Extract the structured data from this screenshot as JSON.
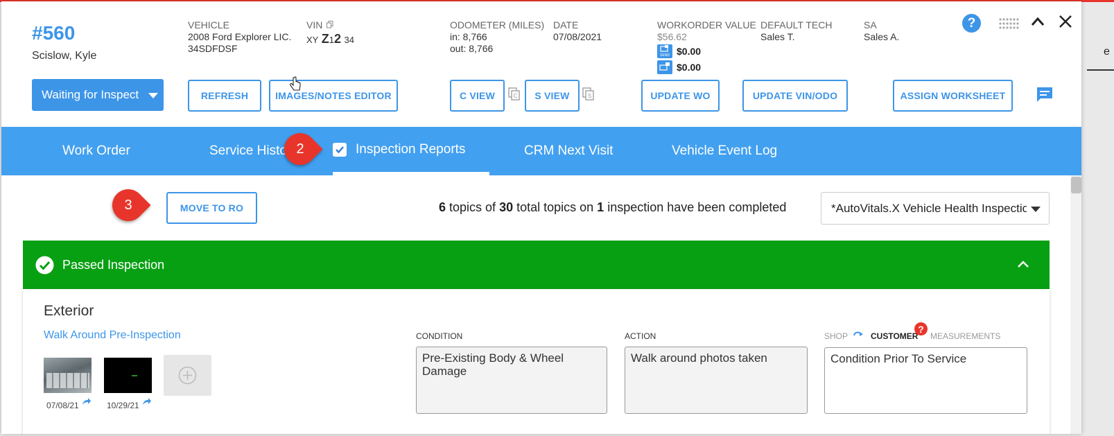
{
  "header": {
    "wo_number": "#560",
    "customer": "Scislow, Kyle",
    "vehicle_label": "VEHICLE",
    "vehicle_line1": "2008 Ford Explorer LIC.",
    "vehicle_line2": "34SDFDSF",
    "vin_label": "VIN",
    "vin_part1": "XY",
    "vin_part2": "Z",
    "vin_part3": "1",
    "vin_part4": "2",
    "vin_part5": "34",
    "odometer_label": "ODOMETER (MILES)",
    "odometer_in": "in: 8,766",
    "odometer_out": "out: 8,766",
    "date_label": "DATE",
    "date_value": "07/08/2021",
    "wo_value_label": "WORKORDER VALUE",
    "wo_value": "$56.62",
    "send_amount": "$0.00",
    "send_icon_text": "SEND",
    "second_amount": "$0.00",
    "tech_label": "DEFAULT TECH",
    "tech_value": "Sales T.",
    "sa_label": "SA",
    "sa_value": "Sales A."
  },
  "toolbar": {
    "status": "Waiting for Inspect",
    "refresh": "REFRESH",
    "images_notes": "IMAGES/NOTES EDITOR",
    "c_view": "C VIEW",
    "s_view": "S VIEW",
    "update_wo": "UPDATE WO",
    "update_vin": "UPDATE VIN/ODO",
    "assign_worksheet": "ASSIGN WORKSHEET"
  },
  "tabs": [
    {
      "label": "Work Order"
    },
    {
      "label": "Service Histo"
    },
    {
      "label": "Inspection Reports"
    },
    {
      "label": "CRM Next Visit"
    },
    {
      "label": "Vehicle Event Log"
    }
  ],
  "badges": {
    "b2": "2",
    "b3": "3",
    "help": "?"
  },
  "content": {
    "move_to_ro": "MOVE TO RO",
    "topics_done": "6",
    "topics_text1": " topics of ",
    "topics_total": "30",
    "topics_text2": " total topics on ",
    "inspections": "1",
    "topics_text3": " inspection have been completed",
    "inspection_select": "*AutoVitals.X Vehicle Health Inspection",
    "passed_title": "Passed Inspection",
    "section_title": "Exterior",
    "item_title": "Walk Around Pre-Inspection",
    "thumb1_date": "07/08/21",
    "thumb2_date": "10/29/21",
    "condition_label": "CONDITION",
    "condition_value": "Pre-Existing Body & Wheel Damage",
    "action_label": "ACTION",
    "action_value": "Walk around photos taken",
    "shop_label": "SHOP",
    "customer_label": "CUSTOMER",
    "measurements_label": "MEASUREMENTS",
    "customer_value": "Condition Prior To Service",
    "outside_text": "e"
  },
  "colors": {
    "accent": "#3d95e8",
    "tabbar": "#42a0f0",
    "passed": "#08a013",
    "badge": "#e8352b"
  }
}
